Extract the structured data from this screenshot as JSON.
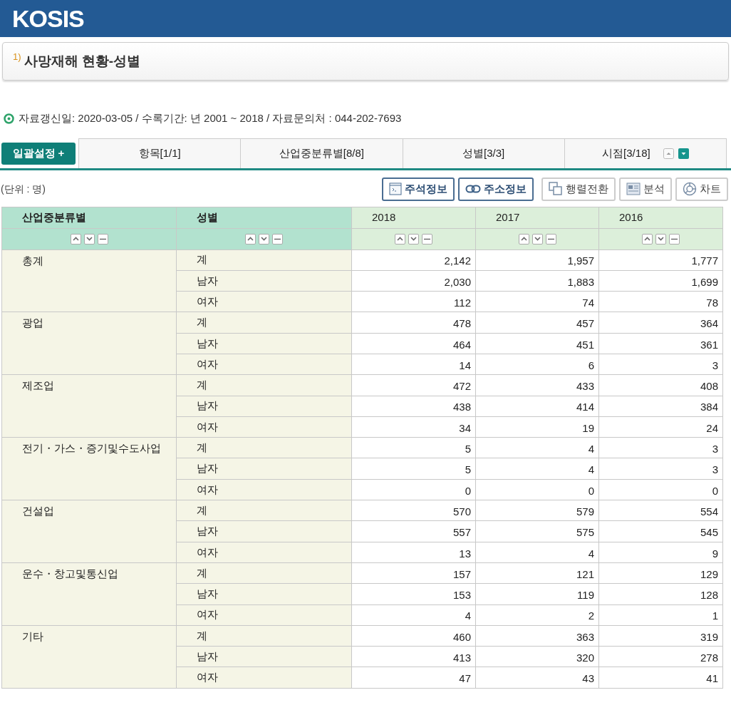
{
  "header": {
    "logo": "KOSIS"
  },
  "title": {
    "footnote": "1)",
    "text": "사망재해 현황-성별"
  },
  "info": "자료갱신일: 2020-03-05 / 수록기간: 년 2001 ~ 2018 / 자료문의처 : 044-202-7693",
  "batch_button": {
    "label": "일괄설정",
    "icon": "+"
  },
  "tabs": [
    {
      "label": "항목[1/1]"
    },
    {
      "label": "산업중분류별[8/8]"
    },
    {
      "label": "성별[3/3]"
    },
    {
      "label": "시점[3/18]"
    }
  ],
  "unit": "(단위 : 명)",
  "toolbar": [
    {
      "label": "주석정보",
      "kind": "note",
      "primary": true
    },
    {
      "label": "주소정보",
      "kind": "link",
      "primary": true
    },
    {
      "label": "행렬전환",
      "kind": "swap",
      "primary": false
    },
    {
      "label": "분석",
      "kind": "analysis",
      "primary": false
    },
    {
      "label": "차트",
      "kind": "chart",
      "primary": false
    }
  ],
  "table": {
    "columns": [
      "산업중분류별",
      "성별",
      "2018",
      "2017",
      "2016"
    ],
    "groups": [
      {
        "name": "총계",
        "rows": [
          [
            "계",
            "2,142",
            "1,957",
            "1,777"
          ],
          [
            "남자",
            "2,030",
            "1,883",
            "1,699"
          ],
          [
            "여자",
            "112",
            "74",
            "78"
          ]
        ]
      },
      {
        "name": "광업",
        "rows": [
          [
            "계",
            "478",
            "457",
            "364"
          ],
          [
            "남자",
            "464",
            "451",
            "361"
          ],
          [
            "여자",
            "14",
            "6",
            "3"
          ]
        ]
      },
      {
        "name": "제조업",
        "rows": [
          [
            "계",
            "472",
            "433",
            "408"
          ],
          [
            "남자",
            "438",
            "414",
            "384"
          ],
          [
            "여자",
            "34",
            "19",
            "24"
          ]
        ]
      },
      {
        "name": "전기・가스・증기및수도사업",
        "rows": [
          [
            "계",
            "5",
            "4",
            "3"
          ],
          [
            "남자",
            "5",
            "4",
            "3"
          ],
          [
            "여자",
            "0",
            "0",
            "0"
          ]
        ]
      },
      {
        "name": "건설업",
        "rows": [
          [
            "계",
            "570",
            "579",
            "554"
          ],
          [
            "남자",
            "557",
            "575",
            "545"
          ],
          [
            "여자",
            "13",
            "4",
            "9"
          ]
        ]
      },
      {
        "name": "운수・창고및통신업",
        "rows": [
          [
            "계",
            "157",
            "121",
            "129"
          ],
          [
            "남자",
            "153",
            "119",
            "128"
          ],
          [
            "여자",
            "4",
            "2",
            "1"
          ]
        ]
      },
      {
        "name": "기타",
        "rows": [
          [
            "계",
            "460",
            "363",
            "319"
          ],
          [
            "남자",
            "413",
            "320",
            "278"
          ],
          [
            "여자",
            "47",
            "43",
            "41"
          ]
        ]
      }
    ]
  }
}
